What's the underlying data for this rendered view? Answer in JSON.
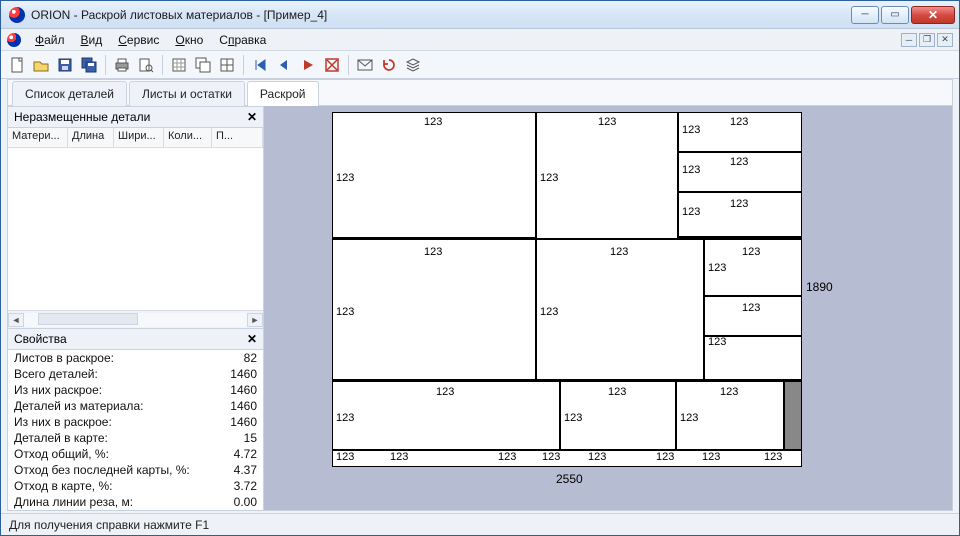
{
  "title": "ORION - Раскрой листовых материалов - [Пример_4]",
  "menu": {
    "file": "Файл",
    "view": "Вид",
    "service": "Сервис",
    "window": "Окно",
    "help": "Справка"
  },
  "tabs": {
    "t1": "Список деталей",
    "t2": "Листы и остатки",
    "t3": "Раскрой"
  },
  "left": {
    "unplaced_title": "Неразмещенные детали",
    "cols": {
      "c1": "Матери...",
      "c2": "Длина",
      "c3": "Шири...",
      "c4": "Коли...",
      "c5": "П..."
    },
    "props_title": "Свойства",
    "props": [
      {
        "label": "Листов в раскрое:",
        "value": "82"
      },
      {
        "label": "Всего деталей:",
        "value": "1460"
      },
      {
        "label": "Из них раскрое:",
        "value": "1460"
      },
      {
        "label": "Деталей из материала:",
        "value": "1460"
      },
      {
        "label": "Из них в раскрое:",
        "value": "1460"
      },
      {
        "label": "Деталей в карте:",
        "value": "15"
      },
      {
        "label": "Отход общий, %:",
        "value": "4.72"
      },
      {
        "label": "Отход без последней карты, %:",
        "value": "4.37"
      },
      {
        "label": "Отход в карте, %:",
        "value": "3.72"
      },
      {
        "label": "Длина линии реза, м:",
        "value": "0.00"
      }
    ]
  },
  "dims": {
    "width": "2550",
    "height": "1890"
  },
  "cell": "123",
  "status": "Для получения справки нажмите F1"
}
